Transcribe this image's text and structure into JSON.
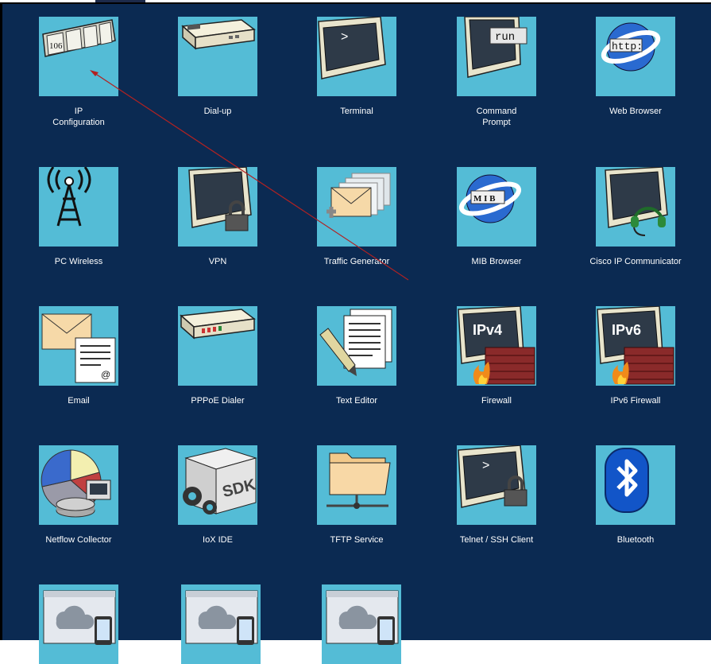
{
  "desktop": {
    "apps": [
      {
        "label": "IP\nConfiguration",
        "icon": "ip-configuration-icon"
      },
      {
        "label": "Dial-up",
        "icon": "dialup-modem-icon"
      },
      {
        "label": "Terminal",
        "icon": "terminal-icon"
      },
      {
        "label": "Command\nPrompt",
        "icon": "command-prompt-icon"
      },
      {
        "label": "Web Browser",
        "icon": "web-browser-icon"
      },
      {
        "label": "PC Wireless",
        "icon": "wireless-tower-icon"
      },
      {
        "label": "VPN",
        "icon": "vpn-lock-monitor-icon"
      },
      {
        "label": "Traffic Generator",
        "icon": "traffic-generator-icon"
      },
      {
        "label": "MIB Browser",
        "icon": "mib-browser-icon"
      },
      {
        "label": "Cisco IP Communicator",
        "icon": "ip-communicator-headset-icon"
      },
      {
        "label": "Email",
        "icon": "email-icon"
      },
      {
        "label": "PPPoE Dialer",
        "icon": "pppoe-modem-icon"
      },
      {
        "label": "Text Editor",
        "icon": "text-editor-icon"
      },
      {
        "label": "Firewall",
        "icon": "ipv4-firewall-icon"
      },
      {
        "label": "IPv6 Firewall",
        "icon": "ipv6-firewall-icon"
      },
      {
        "label": "Netflow Collector",
        "icon": "netflow-collector-icon"
      },
      {
        "label": "IoX IDE",
        "icon": "iox-sdk-icon"
      },
      {
        "label": "TFTP Service",
        "icon": "tftp-folder-icon"
      },
      {
        "label": "Telnet / SSH Client",
        "icon": "telnet-ssh-lock-icon"
      },
      {
        "label": "Bluetooth",
        "icon": "bluetooth-icon"
      },
      {
        "label": "",
        "icon": "cloud-app-icon"
      },
      {
        "label": "",
        "icon": "cloud-app-icon"
      },
      {
        "label": "",
        "icon": "cloud-app-icon"
      }
    ],
    "icon_text": {
      "ip_number": "106",
      "run": "run",
      "http": "http:",
      "mib": "M I B",
      "ipv4": "IPv4",
      "ipv6": "IPv6",
      "sdk": "SDK",
      "prompt": ">"
    },
    "colors": {
      "background": "#0b2a52",
      "tile": "#54bcd6",
      "annotation_arrow": "#b22222"
    }
  }
}
